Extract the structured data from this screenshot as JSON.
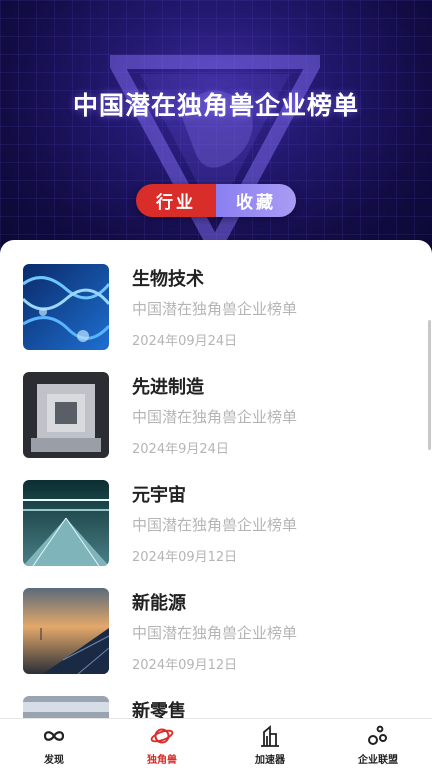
{
  "header": {
    "title": "中国潜在独角兽企业榜单"
  },
  "segment": {
    "items": [
      "行业",
      "收藏"
    ],
    "active_index": 0
  },
  "list": [
    {
      "name": "生物技术",
      "subtitle": "中国潜在独角兽企业榜单",
      "date": "2024年09月24日"
    },
    {
      "name": "先进制造",
      "subtitle": "中国潜在独角兽企业榜单",
      "date": "2024年9月24日"
    },
    {
      "name": "元宇宙",
      "subtitle": "中国潜在独角兽企业榜单",
      "date": "2024年09月12日"
    },
    {
      "name": "新能源",
      "subtitle": "中国潜在独角兽企业榜单",
      "date": "2024年09月12日"
    },
    {
      "name": "新零售",
      "subtitle": "",
      "date": ""
    }
  ],
  "tabbar": {
    "items": [
      {
        "label": "发现",
        "icon": "infinity-icon"
      },
      {
        "label": "独角兽",
        "icon": "planet-icon"
      },
      {
        "label": "加速器",
        "icon": "buildings-icon"
      },
      {
        "label": "企业联盟",
        "icon": "network-icon"
      }
    ],
    "active_index": 1
  },
  "colors": {
    "accent": "#d92d2a",
    "banner_dark": "#120c44",
    "segment_inactive": "#a99cf5"
  }
}
